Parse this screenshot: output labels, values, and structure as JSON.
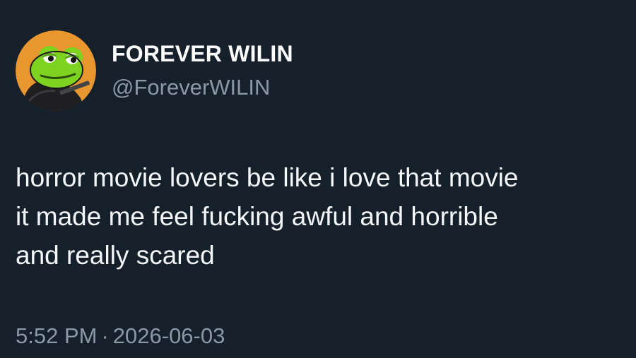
{
  "user": {
    "display_name": "FOREVER WILIN",
    "handle": "@ForeverWILIN",
    "avatar_icon": "frog-cartoon-avatar-icon"
  },
  "tweet": {
    "lines": [
      "horror movie lovers be like i love that movie",
      "it made me feel fucking awful and horrible",
      "and really scared"
    ]
  },
  "meta": {
    "time": "5:52 PM",
    "separator": "·",
    "date": "2026-06-03"
  },
  "colors": {
    "background": "#15202b",
    "text": "#ffffff",
    "secondary_text": "#8b98a5",
    "avatar_bg": "#e8962e",
    "frog_green": "#7ed321"
  }
}
